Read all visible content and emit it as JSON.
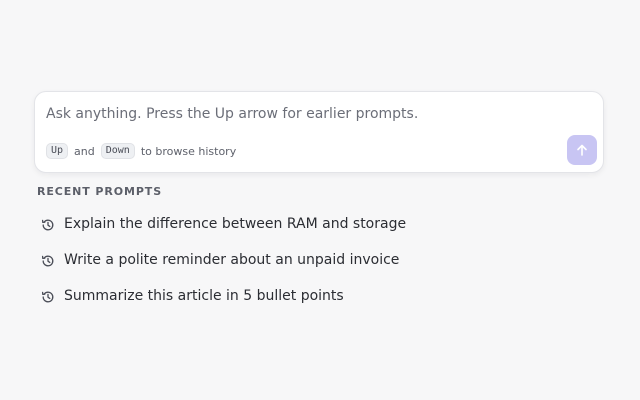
{
  "composer": {
    "placeholder": "Ask anything. Press the Up arrow for earlier prompts.",
    "value": "",
    "hint": {
      "key_up": "Up",
      "and_text": "and",
      "key_down": "Down",
      "suffix": "to browse history"
    },
    "send_icon": "arrow-up-icon",
    "send_button_color": "#c8c5f3"
  },
  "recent": {
    "title": "RECENT PROMPTS",
    "icon": "history-icon",
    "items": [
      {
        "label": "Explain the difference between RAM and storage"
      },
      {
        "label": "Write a polite reminder about an unpaid invoice"
      },
      {
        "label": "Summarize this article in 5 bullet points"
      }
    ]
  }
}
